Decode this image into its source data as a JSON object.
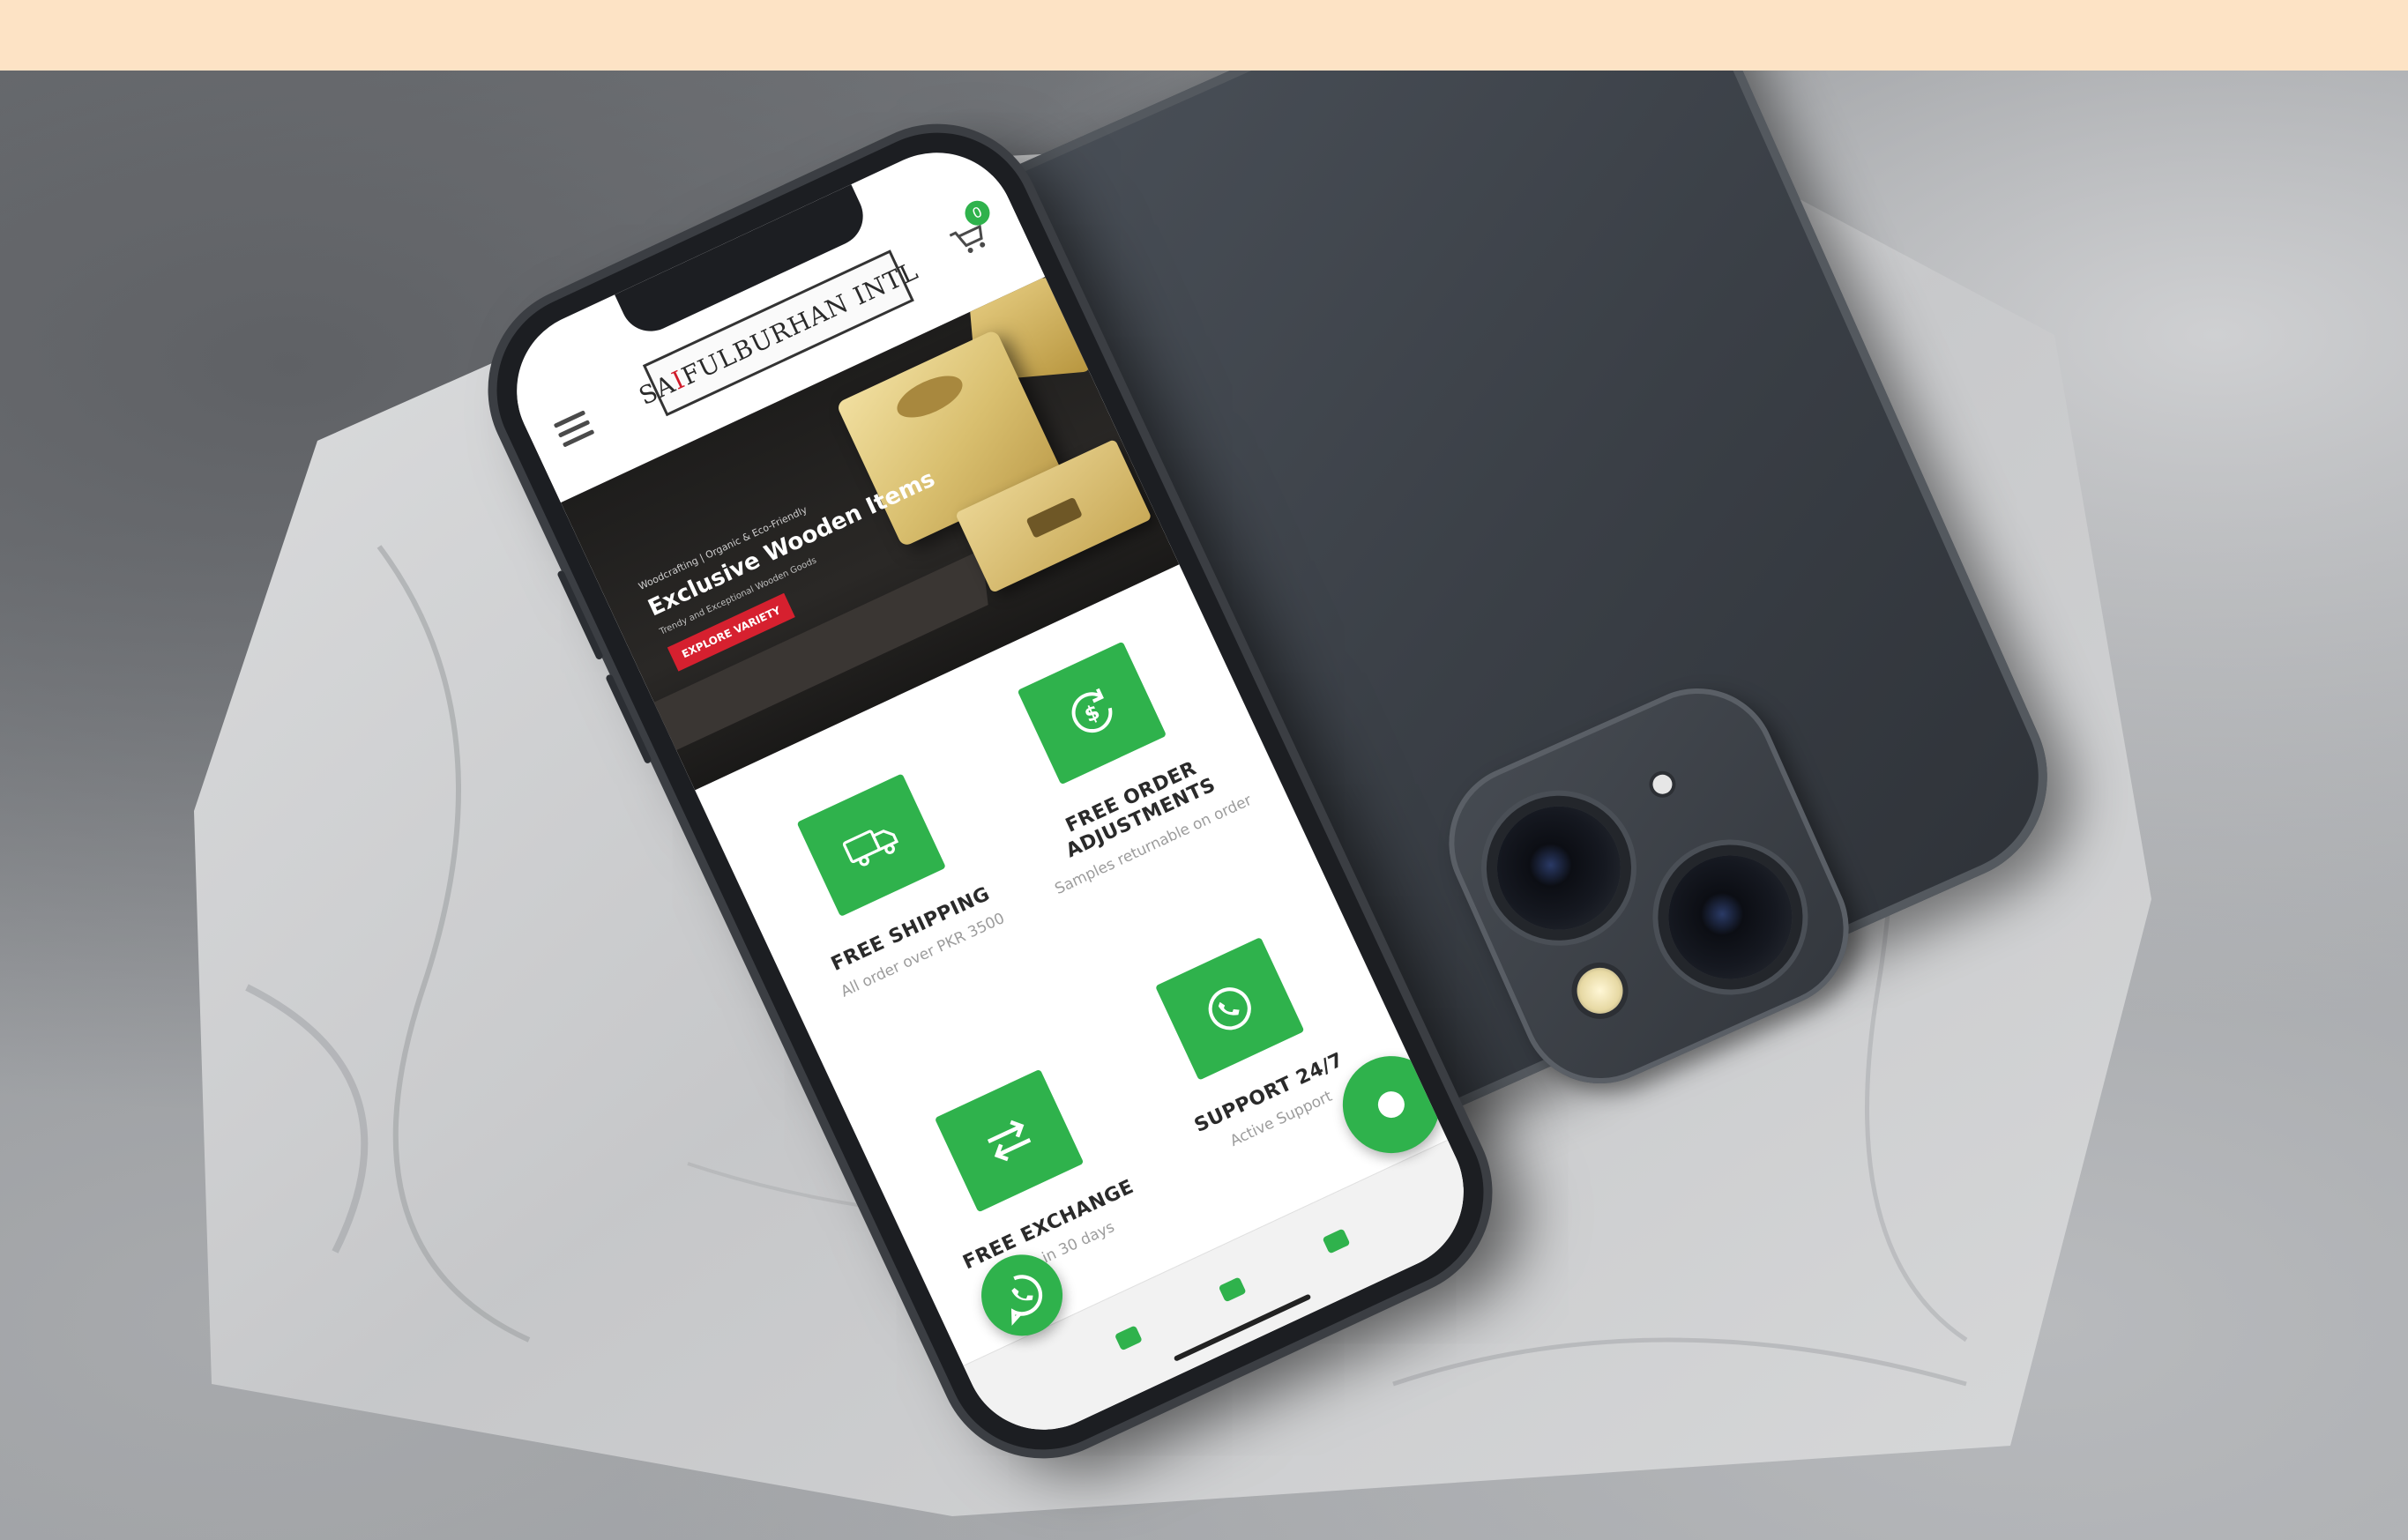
{
  "header": {
    "logo_pre": "SA",
    "logo_mark": "I",
    "logo_post": "FULBURHAN INTL",
    "cart_count": "0",
    "menu_icon": "hamburger-menu-icon",
    "cart_icon": "shopping-cart-icon"
  },
  "hero": {
    "kicker": "Woodcrafting | Organic & Eco-Friendly",
    "title": "Exclusive Wooden Items",
    "subtitle": "Trendy and Exceptional Wooden Goods",
    "button": "EXPLORE VARIETY"
  },
  "features": [
    {
      "title": "FREE SHIPPING",
      "desc": "All order over PKR 3500",
      "icon": "truck-icon"
    },
    {
      "title": "FREE ORDER ADJUSTMENTS",
      "desc": "Samples returnable on order",
      "icon": "dollar-refresh-icon"
    },
    {
      "title": "FREE EXCHANGE",
      "desc": "Only in 30 days",
      "icon": "exchange-arrows-icon"
    },
    {
      "title": "SUPPORT 24/7",
      "desc": "Active Support",
      "icon": "phone-support-icon"
    }
  ],
  "floating": {
    "whatsapp_icon": "whatsapp-icon",
    "chat_icon": "chat-icon"
  },
  "colors": {
    "accent_green": "#2fb24c",
    "hero_button_red": "#d6202f",
    "top_band": "#fde3c5"
  }
}
